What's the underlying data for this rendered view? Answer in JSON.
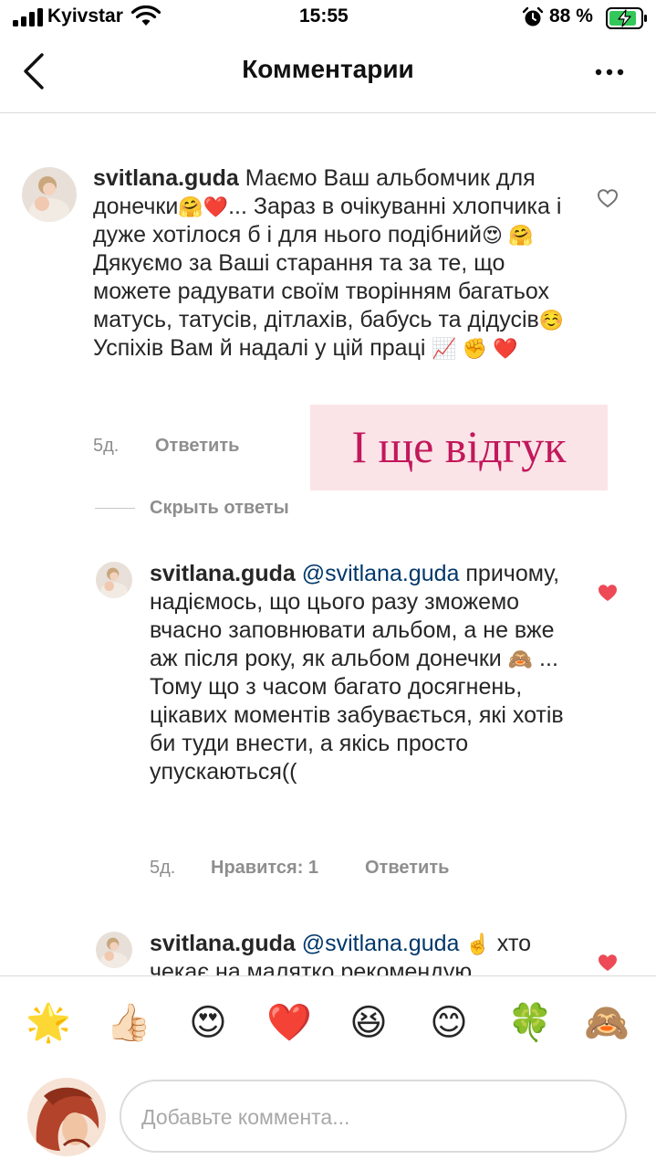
{
  "status_bar": {
    "carrier": "Kyivstar",
    "time": "15:55",
    "battery_percent": "88 %",
    "battery_level": 0.88
  },
  "header": {
    "title": "Комментарии"
  },
  "comments": [
    {
      "username": "svitlana.guda",
      "mention": "",
      "segments": [
        " Маємо Ваш альбомчик для донечки",
        "🤗❤️",
        "... Зараз в очікуванні хлопчика і дуже хотілося б і для нього подібний",
        "😍 🤗",
        " Дякуємо за Ваші старання та за те, що можете радувати своїм творінням багатьох матусь, татусів, дітлахів, бабусь та дідусів",
        "☺️",
        " Успіхів Вам й надалі у цій праці",
        "📈 ✊ ❤️"
      ],
      "time": "5д.",
      "reply_label": "Ответить",
      "liked": false
    },
    {
      "username": "svitlana.guda",
      "mention": "@svitlana.guda",
      "segments": [
        " причому, надіємось, що цього разу зможемо вчасно заповнювати альбом, а не вже аж після року, як альбом донечки ",
        "🙈",
        " ... Тому що з часом багато досягнень, цікавих моментів забувається, які хотів би туди внести, а якісь просто упускаються(("
      ],
      "time": "5д.",
      "likes_label": "Нравится: 1",
      "reply_label": "Ответить",
      "liked": true
    },
    {
      "username": "svitlana.guda",
      "mention": "@svitlana.guda",
      "segments": [
        " ",
        "☝️",
        " хто чекає на малятко рекомендую"
      ],
      "liked": true
    }
  ],
  "hide_replies_label": "Скрыть ответы",
  "overlay_text": "І ще відгук",
  "quick_emojis": [
    "🌟",
    "👍🏻",
    "😍",
    "❤️",
    "😆",
    "😊",
    "🍀",
    "🙈"
  ],
  "comment_input": {
    "placeholder": "Добавьте коммента..."
  },
  "colors": {
    "heart_liked": "#ed4956",
    "overlay_bg": "#fbe4e8",
    "overlay_text": "#c2185b",
    "mention": "#00376b"
  }
}
